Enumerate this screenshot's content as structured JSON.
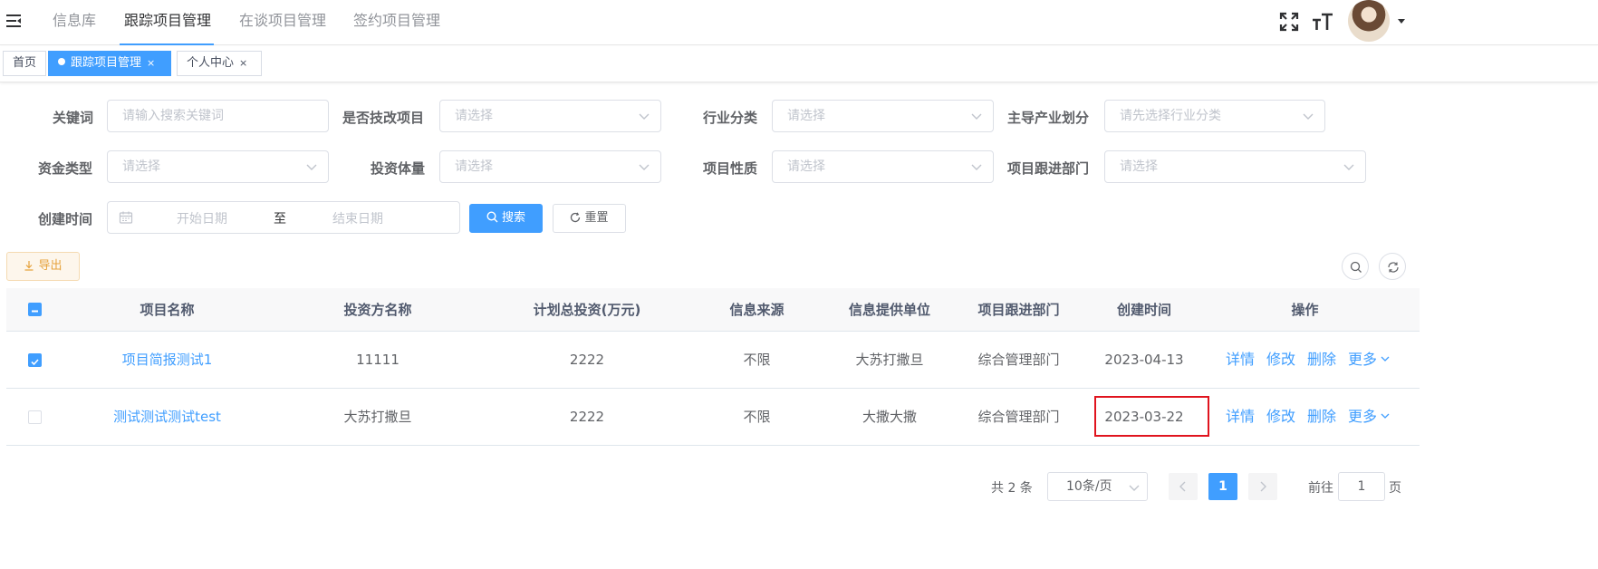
{
  "nav": {
    "menu": [
      "信息库",
      "跟踪项目管理",
      "在谈项目管理",
      "签约项目管理"
    ],
    "active_index": 1
  },
  "tags": {
    "home": "首页",
    "active": "跟踪项目管理",
    "profile": "个人中心",
    "close_glyph": "×"
  },
  "filters": {
    "keyword": {
      "label": "关键词",
      "placeholder": "请输入搜索关键词"
    },
    "tech_reform": {
      "label": "是否技改项目",
      "placeholder": "请选择"
    },
    "industry": {
      "label": "行业分类",
      "placeholder": "请选择"
    },
    "lead_industry": {
      "label": "主导产业划分",
      "placeholder": "请先选择行业分类"
    },
    "fund_type": {
      "label": "资金类型",
      "placeholder": "请选择"
    },
    "invest_scale": {
      "label": "投资体量",
      "placeholder": "请选择"
    },
    "project_nature": {
      "label": "项目性质",
      "placeholder": "请选择"
    },
    "follow_dept": {
      "label": "项目跟进部门",
      "placeholder": "请选择"
    },
    "created": {
      "label": "创建时间",
      "start_placeholder": "开始日期",
      "separator": "至",
      "end_placeholder": "结束日期"
    }
  },
  "buttons": {
    "search": "搜索",
    "reset": "重置",
    "export": "导出"
  },
  "table": {
    "headers": [
      "项目名称",
      "投资方名称",
      "计划总投资(万元)",
      "信息来源",
      "信息提供单位",
      "项目跟进部门",
      "创建时间",
      "操作"
    ],
    "rows": [
      {
        "checked": true,
        "name": "项目简报测试1",
        "investor": "11111",
        "total": "2222",
        "source": "不限",
        "provider": "大苏打撒旦",
        "dept": "综合管理部门",
        "created": "2023-04-13"
      },
      {
        "checked": false,
        "name": "测试测试测试test",
        "investor": "大苏打撒旦",
        "total": "2222",
        "source": "不限",
        "provider": "大撒大撒",
        "dept": "综合管理部门",
        "created": "2023-03-22"
      }
    ],
    "actions": {
      "detail": "详情",
      "edit": "修改",
      "delete": "删除",
      "more": "更多"
    }
  },
  "pagination": {
    "total_text": "共 2 条",
    "page_size": "10条/页",
    "current_page": "1",
    "goto_label": "前往",
    "goto_value": "1",
    "page_suffix": "页"
  },
  "colors": {
    "primary": "#409eff",
    "warning": "#e6a23c",
    "highlight": "#e0141e"
  }
}
